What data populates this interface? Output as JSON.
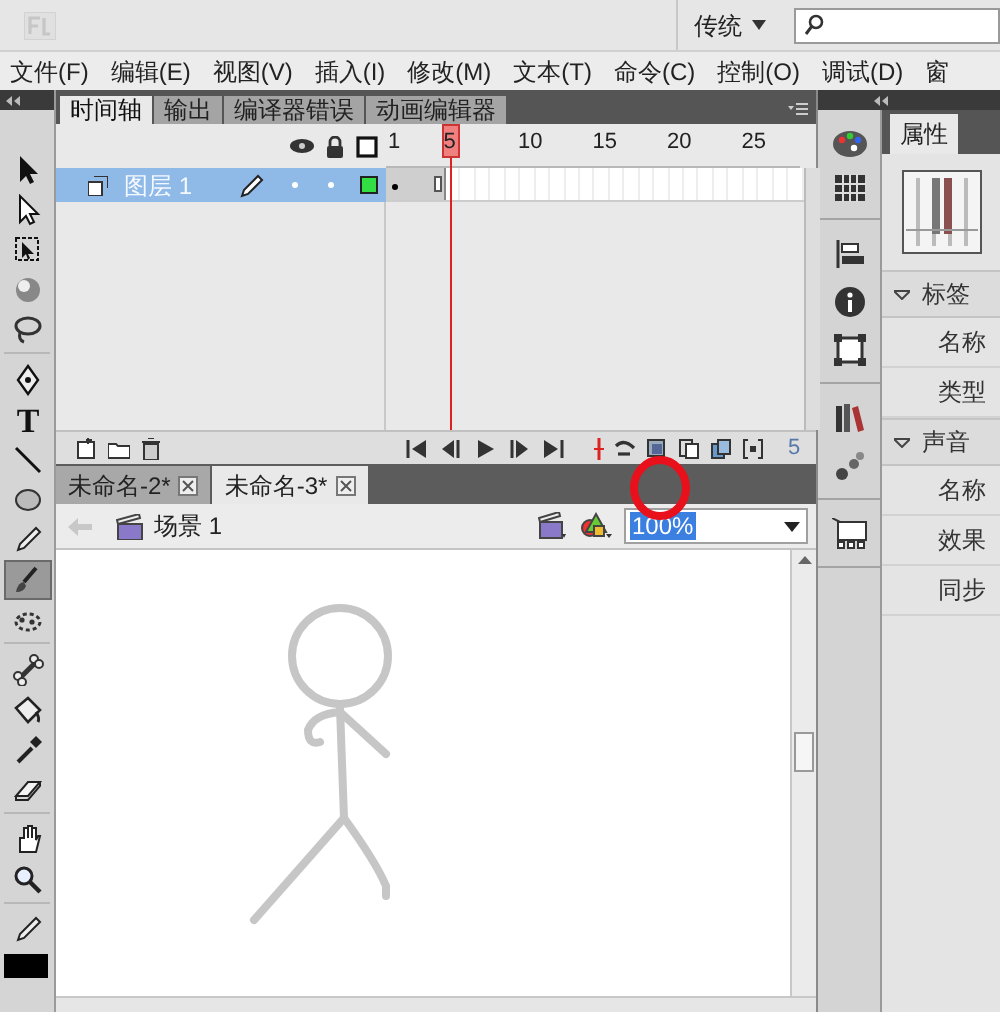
{
  "app_bar": {
    "workspace": "传统"
  },
  "menu": [
    "文件(F)",
    "编辑(E)",
    "视图(V)",
    "插入(I)",
    "修改(M)",
    "文本(T)",
    "命令(C)",
    "控制(O)",
    "调试(D)",
    "窗"
  ],
  "tools": [
    {
      "kind": "selection",
      "selected": false
    },
    {
      "kind": "subselection",
      "selected": false
    },
    {
      "kind": "free-transform",
      "selected": false
    },
    {
      "kind": "sphere",
      "selected": false
    },
    {
      "kind": "lasso",
      "selected": false
    },
    {
      "kind": "gap"
    },
    {
      "kind": "pen",
      "selected": false
    },
    {
      "kind": "text",
      "label": "T",
      "selected": false
    },
    {
      "kind": "line",
      "selected": false
    },
    {
      "kind": "oval",
      "selected": false
    },
    {
      "kind": "pencil",
      "selected": false
    },
    {
      "kind": "brush",
      "selected": true
    },
    {
      "kind": "deco",
      "selected": false
    },
    {
      "kind": "gap"
    },
    {
      "kind": "bone",
      "selected": false
    },
    {
      "kind": "bucket",
      "selected": false
    },
    {
      "kind": "eyedropper",
      "selected": false
    },
    {
      "kind": "eraser",
      "selected": false
    },
    {
      "kind": "gap"
    },
    {
      "kind": "hand",
      "selected": false
    },
    {
      "kind": "zoom",
      "selected": false
    },
    {
      "kind": "gap"
    },
    {
      "kind": "stroke",
      "selected": false
    },
    {
      "kind": "swatch",
      "selected": false
    }
  ],
  "timeline": {
    "tabs": [
      {
        "label": "时间轴",
        "selected": true
      },
      {
        "label": "输出",
        "selected": false
      },
      {
        "label": "编译器错误",
        "selected": false
      },
      {
        "label": "动画编辑器",
        "selected": false
      }
    ],
    "ruler": [
      "1",
      "5",
      "10",
      "15",
      "20",
      "25"
    ],
    "layers": [
      {
        "name": "图层 1",
        "selected": true
      }
    ],
    "current_frame": "5"
  },
  "documents": [
    {
      "label": "未命名-2*",
      "selected": false
    },
    {
      "label": "未命名-3*",
      "selected": true
    }
  ],
  "edit_bar": {
    "scene": "场景 1",
    "zoom": "100%"
  },
  "properties": {
    "tab": "属性",
    "sections": [
      {
        "title": "标签",
        "expanded": true,
        "rows": [
          "名称",
          "类型"
        ]
      },
      {
        "title": "声音",
        "expanded": true,
        "rows": [
          "名称",
          "效果",
          "同步"
        ]
      }
    ]
  }
}
